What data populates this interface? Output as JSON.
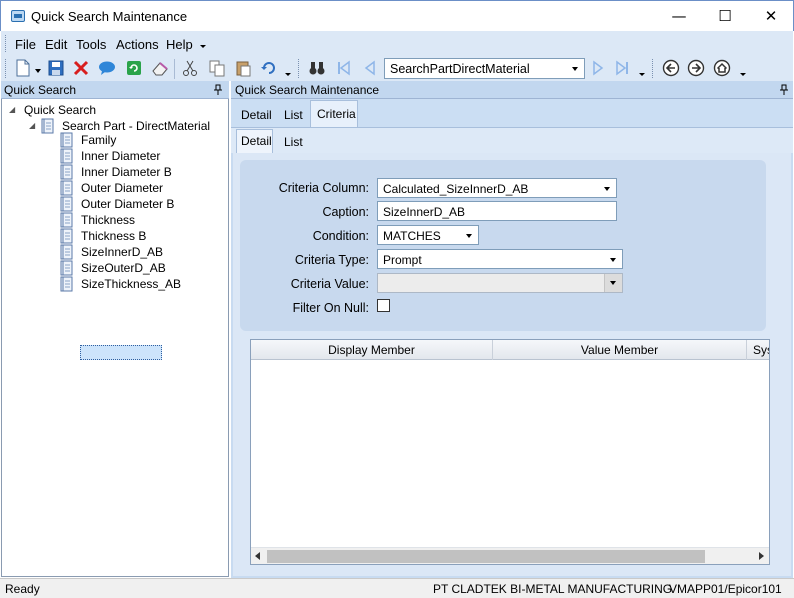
{
  "window": {
    "title": "Quick Search Maintenance",
    "minimize": "—",
    "maximize": "☐",
    "close": "✕"
  },
  "menu": {
    "file": "File",
    "edit": "Edit",
    "tools": "Tools",
    "actions": "Actions",
    "help": "Help"
  },
  "toolbar": {
    "search_combo_value": "SearchPartDirectMaterial"
  },
  "left_panel": {
    "header": "Quick Search",
    "tree": {
      "root": "Quick Search",
      "child": "Search Part - DirectMaterial",
      "items": [
        "Family",
        "Inner Diameter",
        "Inner Diameter B",
        "Outer Diameter",
        "Outer Diameter B",
        "Thickness",
        "Thickness B",
        "SizeInnerD_AB",
        "SizeOuterD_AB",
        "SizeThickness_AB"
      ],
      "selected": "SizeInnerD_AB"
    }
  },
  "right_panel": {
    "header": "Quick Search Maintenance",
    "tabs": [
      "Detail",
      "List",
      "Criteria"
    ],
    "active_tab": "Criteria",
    "subtabs": [
      "Detail",
      "List"
    ],
    "active_subtab": "Detail"
  },
  "form": {
    "criteria_column_label": "Criteria Column:",
    "criteria_column_value": "Calculated_SizeInnerD_AB",
    "caption_label": "Caption:",
    "caption_value": "SizeInnerD_AB",
    "condition_label": "Condition:",
    "condition_value": "MATCHES",
    "criteria_type_label": "Criteria Type:",
    "criteria_type_value": "Prompt",
    "criteria_value_label": "Criteria Value:",
    "criteria_value_value": "",
    "filter_on_null_label": "Filter On Null:",
    "filter_on_null_checked": false
  },
  "grid": {
    "columns": [
      "Display Member",
      "Value Member",
      "Sys"
    ]
  },
  "status": {
    "left": "Ready",
    "company": "PT CLADTEK BI-METAL MANUFACTURING",
    "server": "VMAPP01/Epicor101"
  },
  "colors": {
    "accent": "#c2d7ef",
    "selection": "#cde4fb"
  }
}
